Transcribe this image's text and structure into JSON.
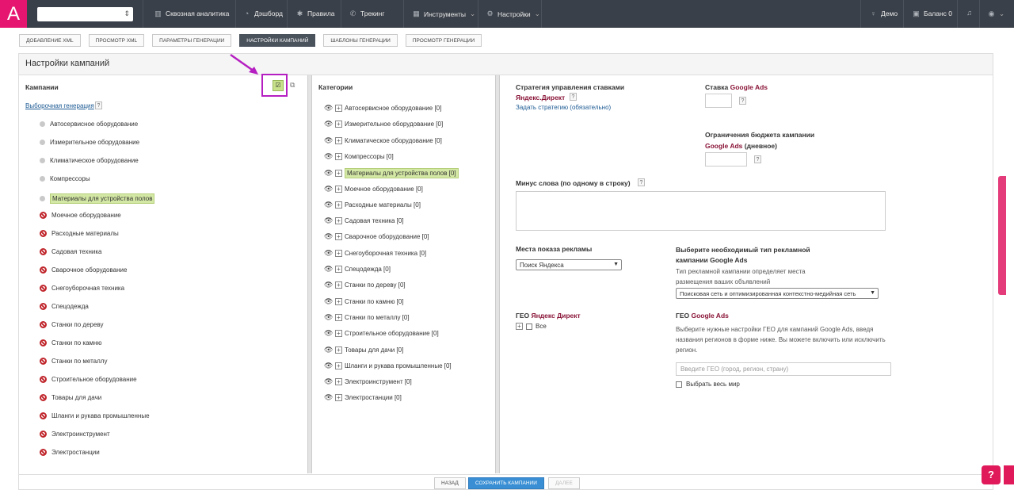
{
  "logo": {
    "text": "A"
  },
  "nav": {
    "items": [
      {
        "label": "Сквозная аналитика",
        "icon": "chart-icon"
      },
      {
        "label": "Дэшборд",
        "icon": "gauge-icon"
      },
      {
        "label": "Правила",
        "icon": "gear-icon"
      },
      {
        "label": "Трекинг",
        "icon": "phone-icon"
      },
      {
        "label": "Инструменты",
        "icon": "grid-icon"
      },
      {
        "label": "Настройки",
        "icon": "settings-icon"
      }
    ],
    "demo": "Демо",
    "balance": "Баланс 0"
  },
  "breadcrumbs": [
    "ДОБАВЛЕНИЕ XML",
    "ПРОСМОТР XML",
    "ПАРАМЕТРЫ ГЕНЕРАЦИИ",
    "НАСТРОЙКИ КАМПАНИЙ",
    "ШАБЛОНЫ ГЕНЕРАЦИИ",
    "ПРОСМОТР ГЕНЕРАЦИИ"
  ],
  "page": {
    "title": "Настройки кампаний"
  },
  "campaigns": {
    "heading": "Кампании",
    "selective_link": "Выборочная генерация",
    "items": [
      {
        "label": "Автосервисное оборудование",
        "state": "neutral"
      },
      {
        "label": "Измерительное оборудование",
        "state": "neutral"
      },
      {
        "label": "Климатическое оборудование",
        "state": "neutral"
      },
      {
        "label": "Компрессоры",
        "state": "neutral"
      },
      {
        "label": "Материалы для устройства полов",
        "state": "selected"
      },
      {
        "label": "Моечное оборудование",
        "state": "disabled"
      },
      {
        "label": "Расходные материалы",
        "state": "disabled"
      },
      {
        "label": "Садовая техника",
        "state": "disabled"
      },
      {
        "label": "Сварочное оборудование",
        "state": "disabled"
      },
      {
        "label": "Снегоуборочная техника",
        "state": "disabled"
      },
      {
        "label": "Спецодежда",
        "state": "disabled"
      },
      {
        "label": "Станки по дереву",
        "state": "disabled"
      },
      {
        "label": "Станки по камню",
        "state": "disabled"
      },
      {
        "label": "Станки по металлу",
        "state": "disabled"
      },
      {
        "label": "Строительное оборудование",
        "state": "disabled"
      },
      {
        "label": "Товары для дачи",
        "state": "disabled"
      },
      {
        "label": "Шланги и рукава промышленные",
        "state": "disabled"
      },
      {
        "label": "Электроинструмент",
        "state": "disabled"
      },
      {
        "label": "Электростанции",
        "state": "disabled"
      }
    ]
  },
  "categories": {
    "heading": "Категории",
    "items": [
      "Автосервисное оборудование [0]",
      "Измерительное оборудование [0]",
      "Климатическое оборудование [0]",
      "Компрессоры [0]",
      "Материалы для устройства полов [0]",
      "Моечное оборудование [0]",
      "Расходные материалы [0]",
      "Садовая техника [0]",
      "Сварочное оборудование [0]",
      "Снегоуборочная техника [0]",
      "Спецодежда [0]",
      "Станки по дереву [0]",
      "Станки по камню [0]",
      "Станки по металлу [0]",
      "Строительное оборудование [0]",
      "Товары для дачи [0]",
      "Шланги и рукава промышленные [0]",
      "Электроинструмент [0]",
      "Электростанции [0]"
    ],
    "selected_index": 4
  },
  "settings": {
    "strategy_label": "Стратегия управления ставками",
    "yandex_direct": "Яндекс.Директ",
    "set_strategy_link": "Задать стратегию (обязательно)",
    "bid_label": "Ставка",
    "google_ads": "Google Ads",
    "budget_label": "Ограничения бюджета кампании",
    "budget_suffix": "(дневное)",
    "minus_words_label": "Минус слова (по одному в строку)",
    "ad_places_label": "Места показа рекламы",
    "ad_places_value": "Поиск Яндекса",
    "campaign_type_label": "Выберите необходимый тип рекламной кампании Google Ads",
    "campaign_type_desc": "Тип рекламной кампании определяет места размещения ваших объявлений",
    "campaign_type_value": "Поисковая сеть и оптимизированная контекстно-медийная сеть",
    "geo_label": "ГЕО",
    "geo_yandex_label": "Яндекс Директ",
    "geo_all": "Все",
    "geo_google_desc": "Выберите нужные настройки ГЕО для кампаний Google Ads, введя названия регионов в форме ниже. Вы можете включить или исключить регион.",
    "geo_placeholder": "Введите ГЕО (город, регион, страну)",
    "select_world": "Выбрать весь мир",
    "help_mark": "?"
  },
  "footer": {
    "back": "НАЗАД",
    "save": "СОХРАНИТЬ КАМПАНИИ",
    "next": "ДАЛЕЕ"
  },
  "help_button": "?",
  "colors": {
    "brand": "#e6156f",
    "topbar": "#3a4049",
    "highlight": "#d4e8a5",
    "primary": "#3a8fd4",
    "annotation": "#b51fc1"
  }
}
